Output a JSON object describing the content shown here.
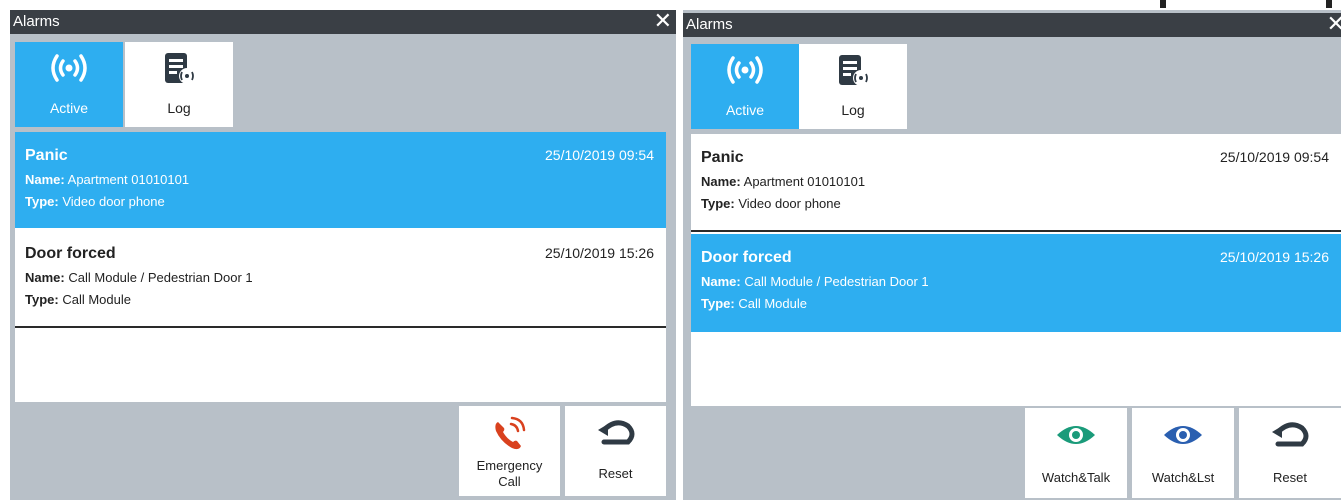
{
  "left_window": {
    "title": "Alarms",
    "close_glyph": "✕",
    "tabs": [
      {
        "label": "Active",
        "icon": "broadcast-icon",
        "active": true
      },
      {
        "label": "Log",
        "icon": "log-list-icon",
        "active": false
      }
    ],
    "alarms": [
      {
        "title": "Panic",
        "date": "25/10/2019 09:54",
        "name_label": "Name:",
        "name": "Apartment 01010101",
        "type_label": "Type:",
        "type": "Video door phone",
        "selected": true
      },
      {
        "title": "Door forced",
        "date": "25/10/2019 15:26",
        "name_label": "Name:",
        "name": "Call Module / Pedestrian Door 1",
        "type_label": "Type:",
        "type": "Call Module",
        "selected": false
      }
    ],
    "buttons": {
      "emergency_call_line1": "Emergency",
      "emergency_call_line2": "Call",
      "reset": "Reset"
    }
  },
  "right_window": {
    "title": "Alarms",
    "close_glyph": "✕",
    "tabs": [
      {
        "label": "Active",
        "icon": "broadcast-icon",
        "active": true
      },
      {
        "label": "Log",
        "icon": "log-list-icon",
        "active": false
      }
    ],
    "alarms": [
      {
        "title": "Panic",
        "date": "25/10/2019 09:54",
        "name_label": "Name:",
        "name": "Apartment 01010101",
        "type_label": "Type:",
        "type": "Video door phone",
        "selected": false
      },
      {
        "title": "Door forced",
        "date": "25/10/2019 15:26",
        "name_label": "Name:",
        "name": "Call Module / Pedestrian Door 1",
        "type_label": "Type:",
        "type": "Call Module",
        "selected": true
      }
    ],
    "buttons": {
      "watch_talk": "Watch&Talk",
      "watch_listen": "Watch&Lst",
      "reset": "Reset"
    }
  },
  "colors": {
    "accent": "#2eaef0",
    "titlebar": "#3a3f45",
    "panel": "#b8c0c8",
    "emergency": "#d9411e",
    "watch_talk": "#1a9b7a",
    "watch_listen": "#2a5fb0",
    "reset_icon": "#2f3a44"
  }
}
